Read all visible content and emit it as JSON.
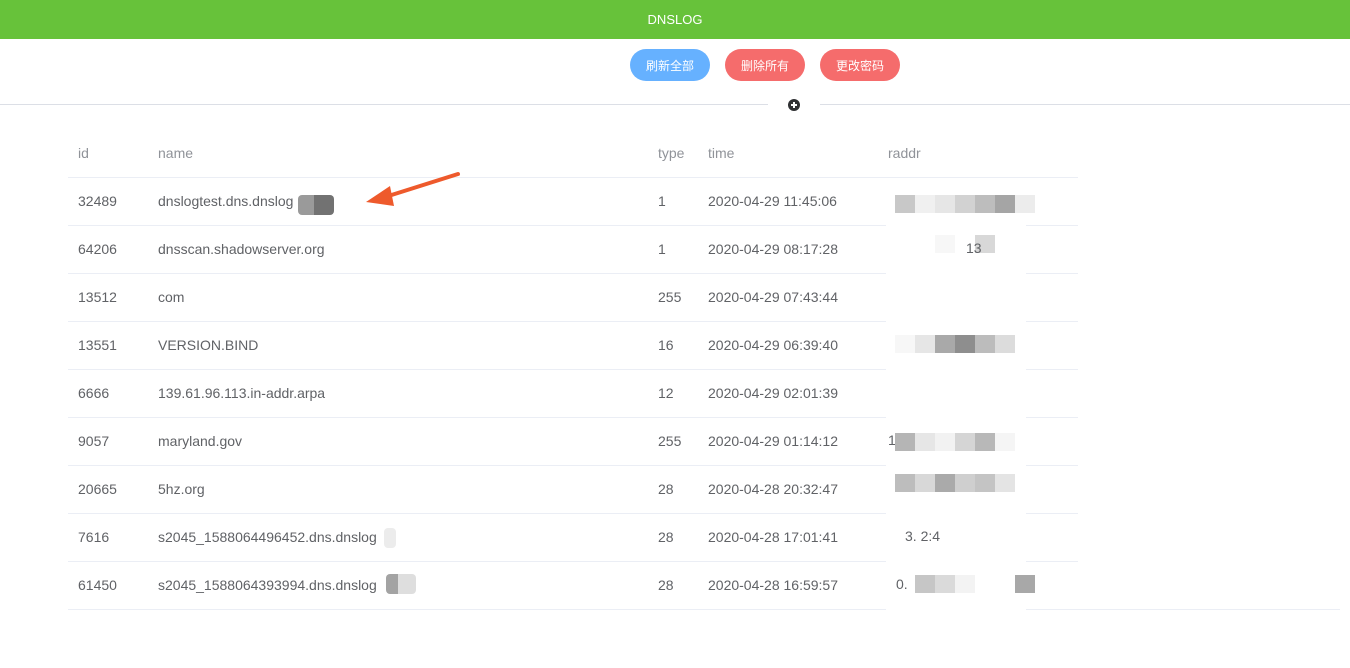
{
  "header": {
    "title": "DNSLOG"
  },
  "toolbar": {
    "refresh_label": "刷新全部",
    "delete_label": "删除所有",
    "password_label": "更改密码"
  },
  "colors": {
    "header_bg": "#67c23a",
    "refresh_btn": "#66b1ff",
    "danger_btn": "#f56c6c",
    "arrow": "#ee5a2c"
  },
  "divider": {
    "icon": "plus-circle-icon"
  },
  "table": {
    "columns": [
      "id",
      "name",
      "type",
      "time",
      "raddr"
    ],
    "rows": [
      {
        "id": "32489",
        "name": "dnslogtest.dns.dnslog",
        "type": "1",
        "time": "2020-04-29 11:45:06",
        "raddr": ""
      },
      {
        "id": "64206",
        "name": "dnsscan.shadowserver.org",
        "type": "1",
        "time": "2020-04-29 08:17:28",
        "raddr": "13"
      },
      {
        "id": "13512",
        "name": "com",
        "type": "255",
        "time": "2020-04-29 07:43:44",
        "raddr": ""
      },
      {
        "id": "13551",
        "name": "VERSION.BIND",
        "type": "16",
        "time": "2020-04-29 06:39:40",
        "raddr": ""
      },
      {
        "id": "6666",
        "name": "139.61.96.113.in-addr.arpa",
        "type": "12",
        "time": "2020-04-29 02:01:39",
        "raddr": ""
      },
      {
        "id": "9057",
        "name": "maryland.gov",
        "type": "255",
        "time": "2020-04-29 01:14:12",
        "raddr": "1"
      },
      {
        "id": "20665",
        "name": "5hz.org",
        "type": "28",
        "time": "2020-04-28 20:32:47",
        "raddr": ""
      },
      {
        "id": "7616",
        "name": "s2045_1588064496452.dns.dnslog",
        "type": "28",
        "time": "2020-04-28 17:01:41",
        "raddr": "3.            2:4"
      },
      {
        "id": "61450",
        "name": "s2045_1588064393994.dns.dnslog",
        "type": "28",
        "time": "2020-04-28 16:59:57",
        "raddr": "0."
      }
    ]
  }
}
